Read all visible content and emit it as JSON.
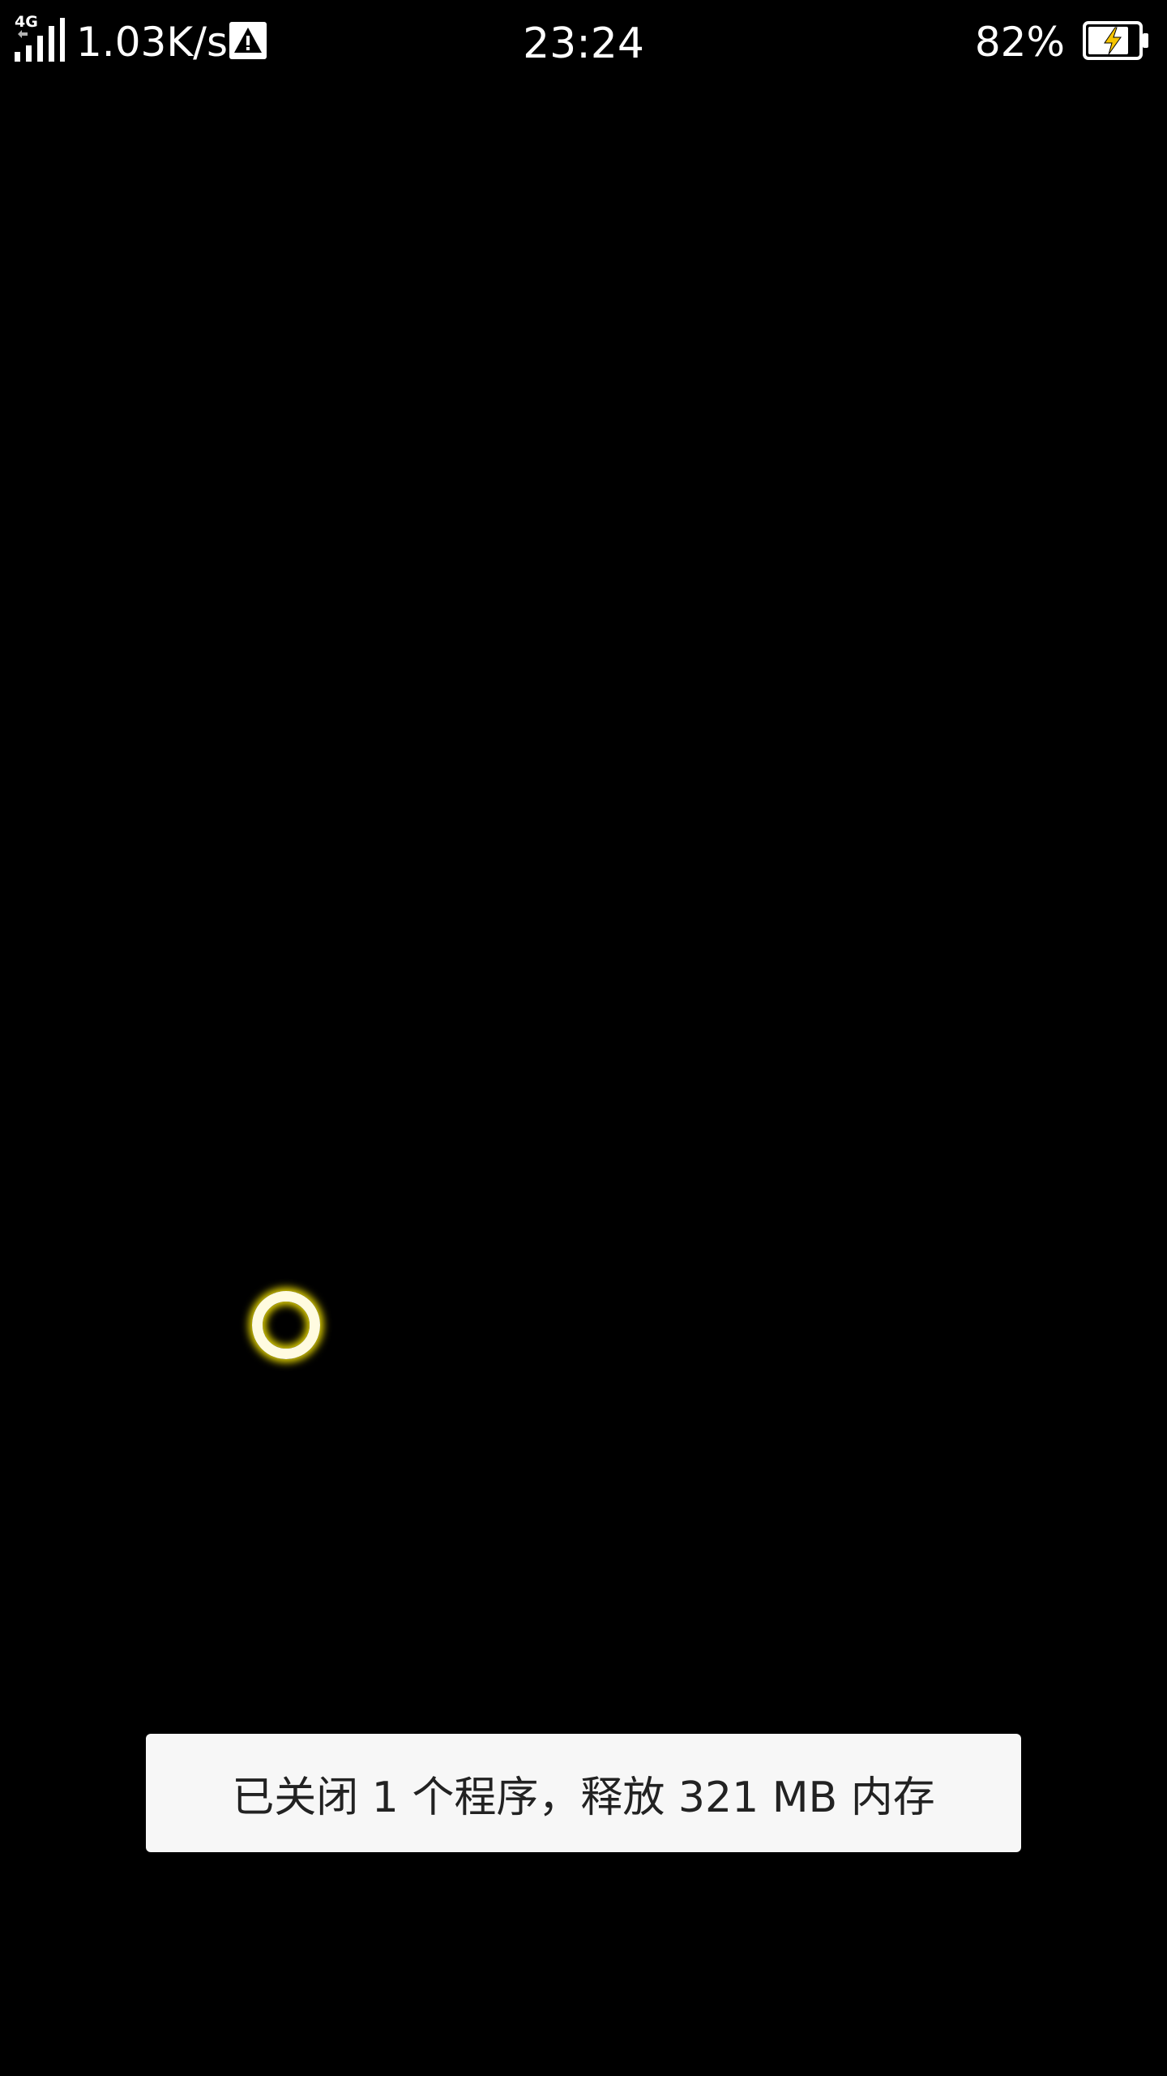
{
  "status_bar": {
    "network_type": "4G",
    "network_speed": "1.03K/s",
    "alert_icon": "warning-triangle-icon",
    "time": "23:24",
    "battery_percent": "82%",
    "battery_level": 0.82,
    "battery_charging": true,
    "signal_icon": "cellular-signal-icon",
    "battery_icon": "battery-charging-icon"
  },
  "touch_indicator": {
    "icon": "touch-point-ring",
    "color": "#e8d800"
  },
  "toast": {
    "message": "已关闭 1 个程序，释放 321 MB 内存"
  },
  "colors": {
    "background": "#000000",
    "status_text": "#ffffff",
    "toast_background": "#f7f7f7",
    "toast_text": "#222222",
    "bolt": "#f5c400"
  }
}
